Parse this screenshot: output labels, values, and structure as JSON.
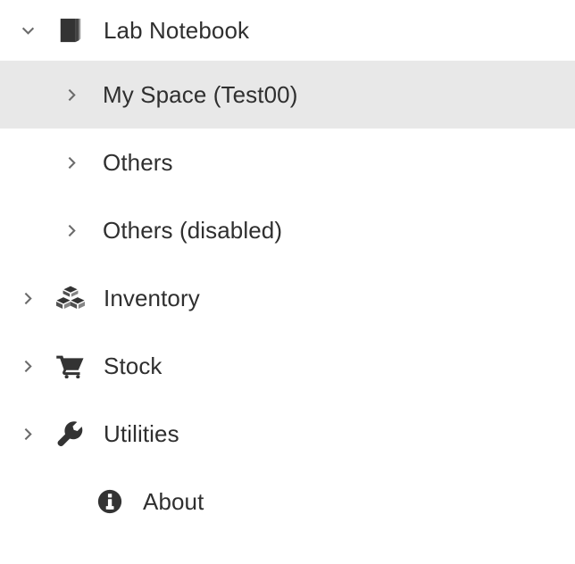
{
  "sidebar": {
    "items": [
      {
        "label": "Lab Notebook",
        "icon": "book-icon",
        "chevron": "chevron-down-icon",
        "level": 0,
        "selected": false,
        "name": "nav-item-lab-notebook"
      },
      {
        "label": "My Space (Test00)",
        "icon": "",
        "chevron": "chevron-right-icon",
        "level": 1,
        "selected": true,
        "name": "nav-item-my-space"
      },
      {
        "label": "Others",
        "icon": "",
        "chevron": "chevron-right-icon",
        "level": 1,
        "selected": false,
        "name": "nav-item-others"
      },
      {
        "label": "Others (disabled)",
        "icon": "",
        "chevron": "chevron-right-icon",
        "level": 1,
        "selected": false,
        "name": "nav-item-others-disabled"
      },
      {
        "label": "Inventory",
        "icon": "boxes-icon",
        "chevron": "chevron-right-icon",
        "level": 0,
        "selected": false,
        "name": "nav-item-inventory"
      },
      {
        "label": "Stock",
        "icon": "shopping-cart-icon",
        "chevron": "chevron-right-icon",
        "level": 0,
        "selected": false,
        "name": "nav-item-stock"
      },
      {
        "label": "Utilities",
        "icon": "wrench-icon",
        "chevron": "chevron-right-icon",
        "level": 0,
        "selected": false,
        "name": "nav-item-utilities"
      },
      {
        "label": "About",
        "icon": "info-circle-icon",
        "chevron": "",
        "level": 0,
        "selected": false,
        "name": "nav-item-about"
      }
    ]
  },
  "colors": {
    "selected_background": "#e8e8e8",
    "text": "#2f2f2f",
    "icon": "#333333",
    "chevron": "#6b6b6b",
    "background": "#ffffff"
  }
}
